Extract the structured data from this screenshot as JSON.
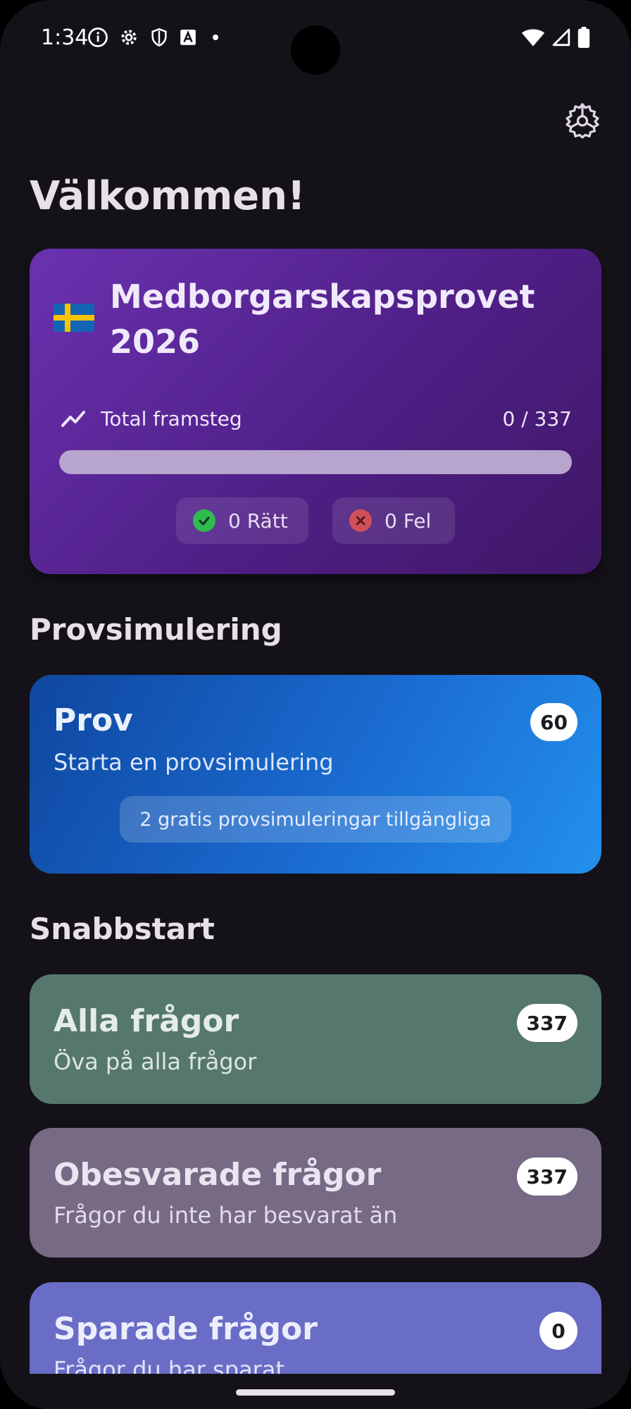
{
  "status_bar": {
    "time": "1:34"
  },
  "header": {
    "welcome": "Välkommen!"
  },
  "progress_card": {
    "title": "Medborgarskapsprovet 2026",
    "progress_label": "Total framsteg",
    "progress_count": "0 / 337",
    "progress_fraction": 0,
    "correct_label": "0 Rätt",
    "wrong_label": "0 Fel"
  },
  "sections": {
    "simulation_heading": "Provsimulering",
    "quickstart_heading": "Snabbstart"
  },
  "prov_tile": {
    "title": "Prov",
    "subtitle": "Starta en provsimulering",
    "badge": "60",
    "free_info": "2 gratis provsimuleringar tillgängliga"
  },
  "quickstart": {
    "all": {
      "title": "Alla frågor",
      "subtitle": "Öva på alla frågor",
      "badge": "337"
    },
    "unanswered": {
      "title": "Obesvarade frågor",
      "subtitle": "Frågor du inte har besvarat än",
      "badge": "337"
    },
    "saved": {
      "title": "Sparade frågor",
      "subtitle": "Frågor du har sparat",
      "badge": "0"
    }
  },
  "colors": {
    "background": "#141218",
    "progress_card": "#5a2596",
    "prov_tile": "#1a6bd0",
    "all_tile": "#56776e",
    "unanswered_tile": "#776a85",
    "saved_tile": "#6a6dc6",
    "correct": "#2fbb4f",
    "wrong": "#d0505a"
  },
  "icons": {
    "settings": "gear-icon",
    "progress": "trending-up-icon",
    "flag": "swedish-flag-icon"
  }
}
